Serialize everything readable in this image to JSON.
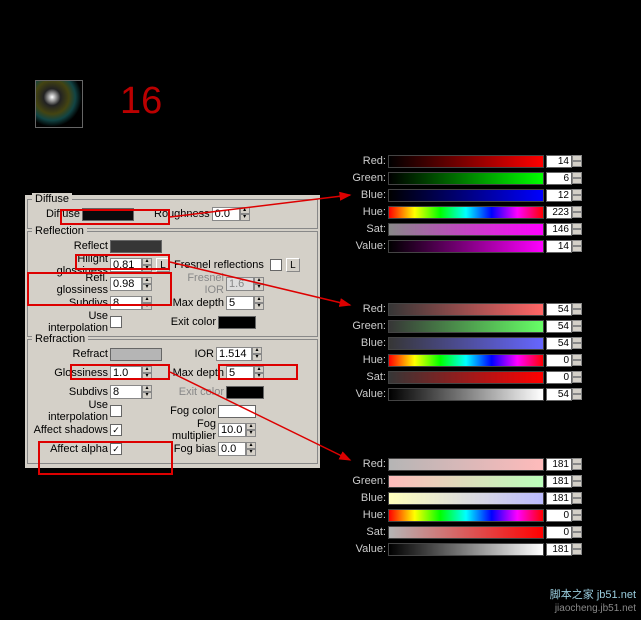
{
  "step_number": "16",
  "groups": {
    "diffuse": {
      "title": "Diffuse",
      "diffuse_lbl": "Diffuse",
      "roughness_lbl": "Roughness",
      "roughness_val": "0.0"
    },
    "reflection": {
      "title": "Reflection",
      "reflect_lbl": "Reflect",
      "hilight_lbl": "Hilight glossiness",
      "hilight_val": "0.81",
      "refl_gloss_lbl": "Refl. glossiness",
      "refl_gloss_val": "0.98",
      "subdivs_lbl": "Subdivs",
      "subdivs_val": "8",
      "interp_lbl": "Use interpolation",
      "fresnel_lbl": "Fresnel reflections",
      "fresnel_ior_lbl": "Fresnel IOR",
      "fresnel_ior_val": "1.6",
      "maxdepth_lbl": "Max depth",
      "maxdepth_val": "5",
      "exit_lbl": "Exit color",
      "L": "L"
    },
    "refraction": {
      "title": "Refraction",
      "refract_lbl": "Refract",
      "ior_lbl": "IOR",
      "ior_val": "1.514",
      "gloss_lbl": "Glossiness",
      "gloss_val": "1.0",
      "subdivs_lbl": "Subdivs",
      "subdivs_val": "8",
      "interp_lbl": "Use interpolation",
      "shadows_lbl": "Affect shadows",
      "alpha_lbl": "Affect alpha",
      "maxdepth_lbl": "Max depth",
      "maxdepth_val": "5",
      "exit_lbl": "Exit color",
      "fog_lbl": "Fog color",
      "fogmult_lbl": "Fog multiplier",
      "fogmult_val": "10.0",
      "fogbias_lbl": "Fog bias",
      "fogbias_val": "0.0"
    }
  },
  "color_labels": {
    "red": "Red:",
    "green": "Green:",
    "blue": "Blue:",
    "hue": "Hue:",
    "sat": "Sat:",
    "value": "Value:"
  },
  "color_panels": {
    "diffuse": {
      "red": "14",
      "green": "6",
      "blue": "12",
      "hue": "223",
      "sat": "146",
      "value": "14"
    },
    "reflect": {
      "red": "54",
      "green": "54",
      "blue": "54",
      "hue": "0",
      "sat": "0",
      "value": "54"
    },
    "refract": {
      "red": "181",
      "green": "181",
      "blue": "181",
      "hue": "0",
      "sat": "0",
      "value": "181"
    }
  },
  "watermark": {
    "line1": "脚本之家 jb51.net",
    "line2": "jiaocheng.jb51.net"
  },
  "check": "✓",
  "chart_data": null
}
